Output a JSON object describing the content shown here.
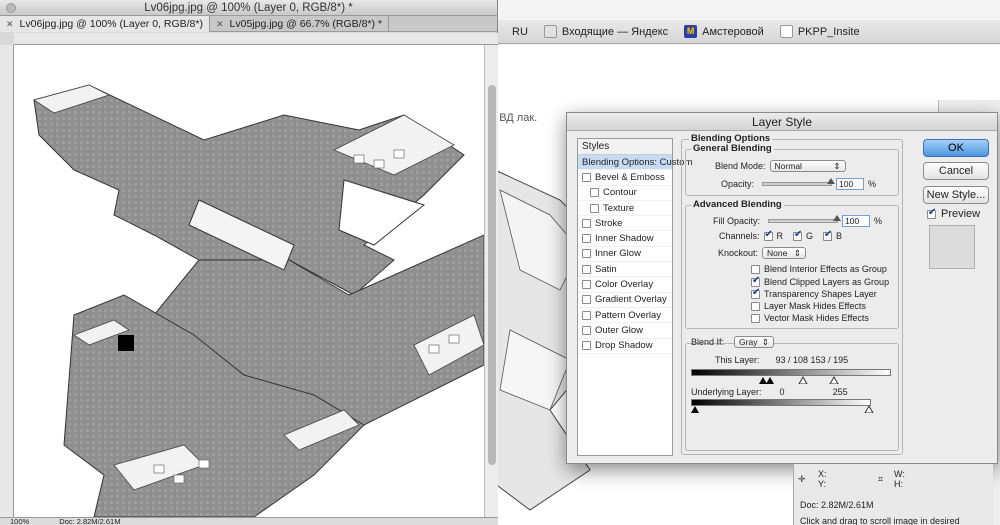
{
  "document": {
    "title": "Lv06jpg.jpg @ 100% (Layer 0, RGB/8*) *",
    "tabs": [
      {
        "label": "Lv06jpg.jpg @ 100% (Layer 0, RGB/8*)"
      },
      {
        "label": "Lv05jpg.jpg @ 66.7% (RGB/8*) *"
      }
    ],
    "zoom": "100%",
    "doc_size": "Doc: 2.82M/2.61M"
  },
  "browser": {
    "bookmarks": [
      {
        "label": "RU"
      },
      {
        "label": "Входящие — Яндекс"
      },
      {
        "label": "Амстеровой"
      },
      {
        "label": "PKPP_Insite"
      }
    ],
    "partial_text": "й ВД лак."
  },
  "dialog": {
    "title": "Layer Style",
    "styles_header": "Styles",
    "styles": [
      {
        "label": "Blending Options: Custom",
        "selected": true,
        "checkbox": false
      },
      {
        "label": "Bevel & Emboss",
        "checkbox": true
      },
      {
        "label": "Contour",
        "checkbox": true,
        "indent": true
      },
      {
        "label": "Texture",
        "checkbox": true,
        "indent": true
      },
      {
        "label": "Stroke",
        "checkbox": true
      },
      {
        "label": "Inner Shadow",
        "checkbox": true
      },
      {
        "label": "Inner Glow",
        "checkbox": true
      },
      {
        "label": "Satin",
        "checkbox": true
      },
      {
        "label": "Color Overlay",
        "checkbox": true
      },
      {
        "label": "Gradient Overlay",
        "checkbox": true
      },
      {
        "label": "Pattern Overlay",
        "checkbox": true
      },
      {
        "label": "Outer Glow",
        "checkbox": true
      },
      {
        "label": "Drop Shadow",
        "checkbox": true
      }
    ],
    "blending": {
      "section": "Blending Options",
      "general": "General Blending",
      "blend_mode_label": "Blend Mode:",
      "blend_mode": "Normal",
      "opacity_label": "Opacity:",
      "opacity": "100",
      "advanced": "Advanced Blending",
      "fill_opacity_label": "Fill Opacity:",
      "fill_opacity": "100",
      "percent": "%",
      "channels_label": "Channels:",
      "channels": [
        "R",
        "G",
        "B"
      ],
      "knockout_label": "Knockout:",
      "knockout": "None",
      "options": [
        {
          "label": "Blend Interior Effects as Group",
          "checked": false
        },
        {
          "label": "Blend Clipped Layers as Group",
          "checked": true
        },
        {
          "label": "Transparency Shapes Layer",
          "checked": true
        },
        {
          "label": "Layer Mask Hides Effects",
          "checked": false
        },
        {
          "label": "Vector Mask Hides Effects",
          "checked": false
        }
      ],
      "blend_if_label": "Blend If:",
      "blend_if": "Gray",
      "this_layer_label": "This Layer:",
      "this_layer_values": "93  /  108        153  /  195",
      "underlying_label": "Underlying Layer:",
      "underlying_min": "0",
      "underlying_max": "255"
    },
    "buttons": {
      "ok": "OK",
      "cancel": "Cancel",
      "new_style": "New Style..."
    },
    "preview_label": "Preview"
  },
  "info": {
    "x_label": "X:",
    "y_label": "Y:",
    "w_label": "W:",
    "h_label": "H:",
    "doc_size": "Doc: 2.82M/2.61M",
    "hint": "Click and drag to scroll image in desired"
  }
}
